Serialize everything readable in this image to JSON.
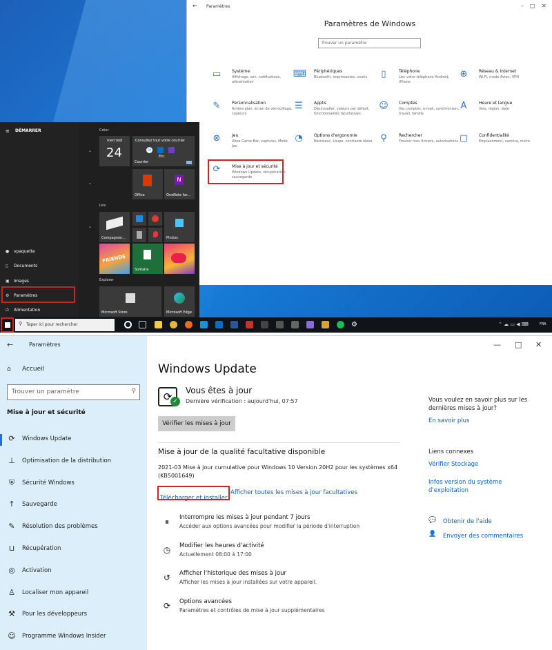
{
  "top": {
    "settings_window": {
      "title": "Paramètres",
      "heading": "Paramètres de Windows",
      "search_placeholder": "Trouver un paramètre",
      "items": [
        {
          "title": "Système",
          "desc": "Affichage, son, notifications, alimentation",
          "icon": "laptop-icon"
        },
        {
          "title": "Périphériques",
          "desc": "Bluetooth, imprimantes, souris",
          "icon": "keyboard-icon"
        },
        {
          "title": "Téléphone",
          "desc": "Lier votre téléphone Android, iPhone",
          "icon": "phone-icon"
        },
        {
          "title": "Réseau & Internet",
          "desc": "Wi-Fi, mode Avion, VPN",
          "icon": "globe-icon"
        },
        {
          "title": "Personnalisation",
          "desc": "Arrière-plan, écran de verrouillage, couleurs",
          "icon": "brush-icon"
        },
        {
          "title": "Applis",
          "desc": "Désinstaller, valeurs par défaut, fonctionnalités facultatives",
          "icon": "apps-icon"
        },
        {
          "title": "Comptes",
          "desc": "Vos comptes, e-mail, synchroniser, travail, famille",
          "icon": "person-icon"
        },
        {
          "title": "Heure et langue",
          "desc": "Voix, région, date",
          "icon": "language-icon"
        },
        {
          "title": "Jeu",
          "desc": "Xbox Game Bar, captures, Mode Jeu",
          "icon": "xbox-icon"
        },
        {
          "title": "Options d'ergonomie",
          "desc": "Narrateur, Loupe, contraste élevé",
          "icon": "ease-of-access-icon"
        },
        {
          "title": "Rechercher",
          "desc": "Trouver mes fichiers, autorisations",
          "icon": "search-icon"
        },
        {
          "title": "Confidentialité",
          "desc": "Emplacement, caméra, micro",
          "icon": "lock-icon"
        },
        {
          "title": "Mise à jour et sécurité",
          "desc": "Windows Update, récupération, sauvegarde",
          "icon": "update-icon"
        }
      ]
    },
    "start_menu": {
      "header": "DÉMARRER",
      "user": "vpaquette",
      "documents": "Documents",
      "images": "Images",
      "settings": "Paramètres",
      "power": "Alimentation",
      "groups": {
        "create": "Créer",
        "play": "Lire",
        "explore": "Explorer"
      },
      "calendar_day": "mercredi",
      "calendar_date": "24",
      "mail_tile_title": "Consultez tout votre courrier",
      "mail_tile_more": "Etc.",
      "mail_label": "Courrier",
      "office_label": "Office",
      "onenote_label": "OneNote for...",
      "companion_label": "Compagnon...",
      "photos_label": "Photos",
      "solitaire_label": "Solitaire",
      "store_label": "Microsoft Store",
      "edge_label": "Microsoft Edge",
      "candy_text": "FRIENDS"
    },
    "taskbar": {
      "search_placeholder": "Taper ici pour rechercher",
      "lang": "FRA"
    }
  },
  "bottom": {
    "nav": {
      "app_title": "Paramètres",
      "home": "Accueil",
      "search_placeholder": "Trouver un paramètre",
      "category": "Mise à jour et sécurité",
      "items": [
        {
          "label": "Windows Update",
          "icon": "sync-icon"
        },
        {
          "label": "Optimisation de la distribution",
          "icon": "delivery-icon"
        },
        {
          "label": "Sécurité Windows",
          "icon": "shield-icon"
        },
        {
          "label": "Sauvegarde",
          "icon": "backup-arrow-icon"
        },
        {
          "label": "Résolution des problèmes",
          "icon": "wrench-icon"
        },
        {
          "label": "Récupération",
          "icon": "recovery-icon"
        },
        {
          "label": "Activation",
          "icon": "check-circle-icon"
        },
        {
          "label": "Localiser mon appareil",
          "icon": "locate-person-icon"
        },
        {
          "label": "Pour les développeurs",
          "icon": "developer-icon"
        },
        {
          "label": "Programme Windows Insider",
          "icon": "insider-icon"
        }
      ]
    },
    "main": {
      "title": "Windows Update",
      "status": "Vous êtes à jour",
      "last_check": "Dernière vérification : aujourd'hui, 07:57",
      "check_button": "Vérifier les mises à jour",
      "optional_heading": "Mise à jour de la qualité facultative disponible",
      "kb_text": "2021-03 Mise à jour cumulative pour Windows 10 Version 20H2 pour les systèmes x64 (KB5001649)",
      "download_link": "Télécharger et installer",
      "view_all_link": "Afficher toutes les mises à jour facultatives",
      "options": [
        {
          "title": "Interrompre les mises à jour pendant 7 jours",
          "desc": "Accéder aux options avancées pour modifier la période d'interruption",
          "icon": "pause-icon"
        },
        {
          "title": "Modifier les heures d'activité",
          "desc": "Actuellement 08:00 à 17:00",
          "icon": "clock-icon"
        },
        {
          "title": "Afficher l'historique des mises à jour",
          "desc": "Afficher les mises à jour installées sur votre appareil.",
          "icon": "history-icon"
        },
        {
          "title": "Options avancées",
          "desc": "Paramètres et contrôles de mise à jour supplémentaires",
          "icon": "advanced-sync-icon"
        }
      ]
    },
    "right": {
      "question": "Vous voulez en savoir plus sur les dernières mises à jour?",
      "learn_more": "En savoir plus",
      "related": "Liens connexes",
      "storage": "Vérifier Stockage",
      "os_info": "Infos version du système d'exploitation",
      "help": "Obtenir de l'aide",
      "feedback": "Envoyer des commentaires"
    }
  },
  "colors": {
    "accent": "#0a5ec2",
    "highlight": "#d32020",
    "nav_bg": "#dceefa"
  }
}
